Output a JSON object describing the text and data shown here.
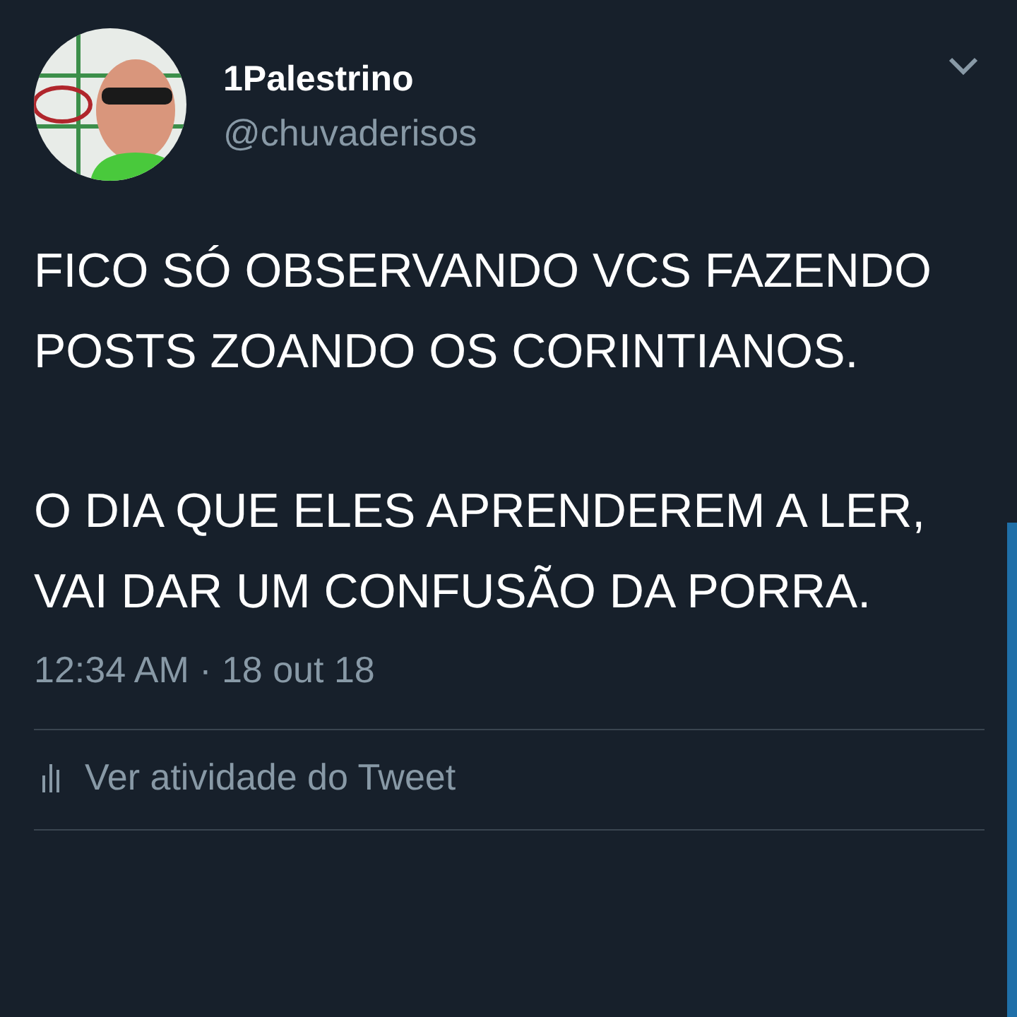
{
  "tweet": {
    "author": {
      "name": "1Palestrino",
      "handle": "@chuvaderisos"
    },
    "menu": {
      "expanded": false
    },
    "paragraphs": [
      "FICO SÓ OBSERVANDO VCS FAZENDO POSTS ZOANDO OS CORINTIANOS.",
      "O DIA QUE ELES APRENDEREM A LER, VAI DAR UM CONFUSÃO DA PORRA."
    ],
    "timestamp": "12:34 AM · 18 out 18",
    "activity_link": "Ver atividade do Tweet"
  }
}
